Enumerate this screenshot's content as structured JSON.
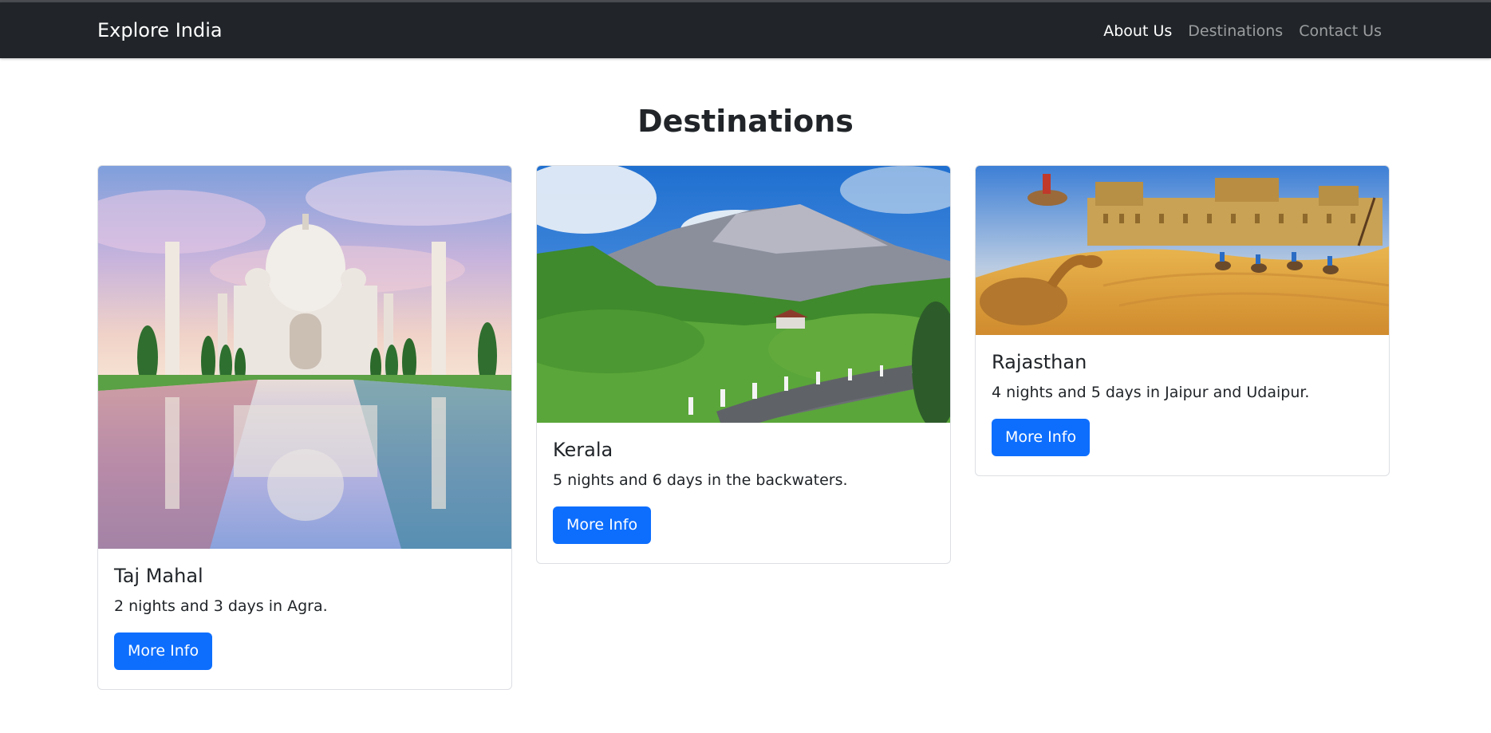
{
  "navbar": {
    "brand": "Explore India",
    "links": [
      {
        "label": "About Us",
        "active": true
      },
      {
        "label": "Destinations",
        "active": false
      },
      {
        "label": "Contact Us",
        "active": false
      }
    ]
  },
  "page": {
    "heading": "Destinations"
  },
  "cards": [
    {
      "title": "Taj Mahal",
      "text": "2 nights and 3 days in Agra.",
      "button": "More Info",
      "image": "taj-mahal-photo"
    },
    {
      "title": "Kerala",
      "text": "5 nights and 6 days in the backwaters.",
      "button": "More Info",
      "image": "kerala-hills-photo"
    },
    {
      "title": "Rajasthan",
      "text": "4 nights and 5 days in Jaipur and Udaipur.",
      "button": "More Info",
      "image": "rajasthan-desert-photo"
    }
  ],
  "colors": {
    "navbar_bg": "#212529",
    "primary_button": "#0d6efd",
    "text": "#212529"
  }
}
